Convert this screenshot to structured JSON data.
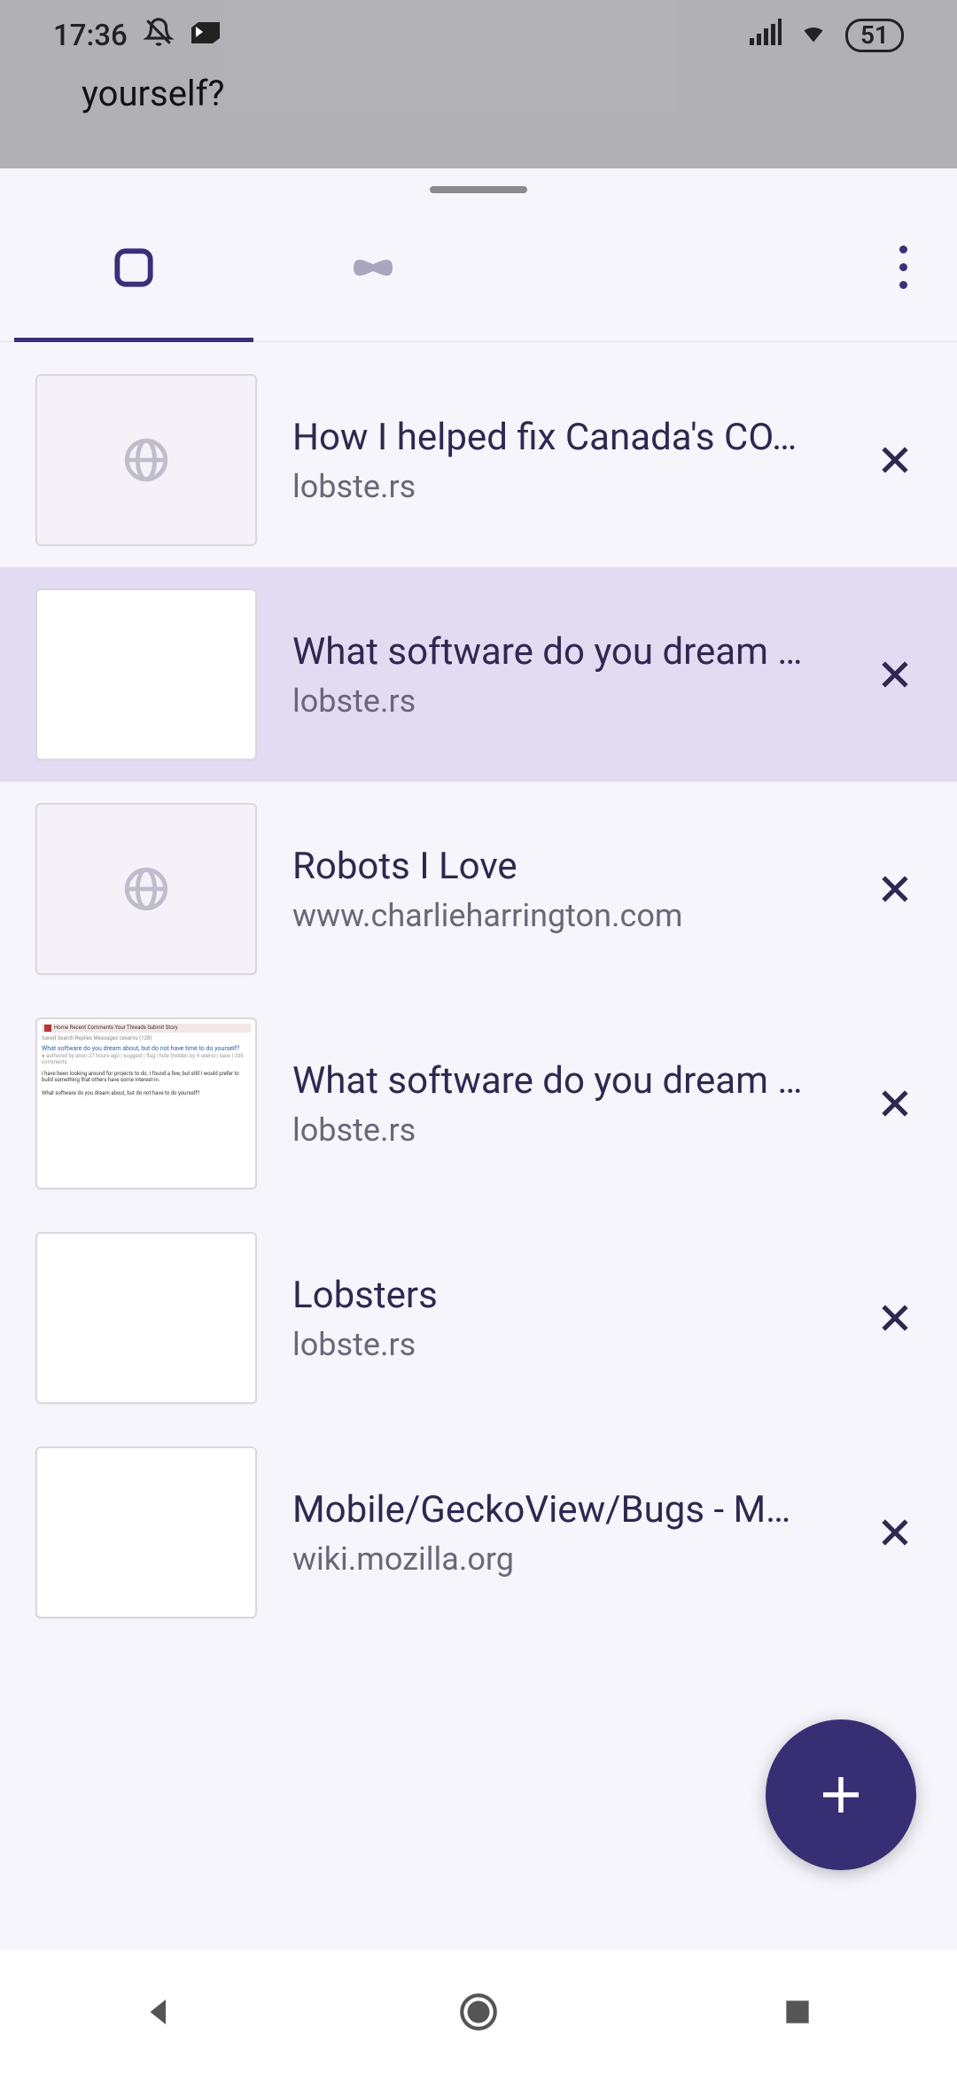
{
  "status": {
    "time": "17:36",
    "battery": "51"
  },
  "underlay": {
    "peek_text": "yourself?"
  },
  "colors": {
    "accent": "#3a2f7a",
    "fab": "#372e74",
    "active_row": "#e2dcf2"
  },
  "tabs": [
    {
      "title": "How I helped fix Canada's CO…",
      "url": "lobste.rs",
      "thumb": "globe",
      "active": false
    },
    {
      "title": "What software do you dream …",
      "url": "lobste.rs",
      "thumb": "blank",
      "active": true
    },
    {
      "title": "Robots I Love",
      "url": "www.charlieharrington.com",
      "thumb": "globe",
      "active": false
    },
    {
      "title": "What software do you dream …",
      "url": "lobste.rs",
      "thumb": "content",
      "active": false
    },
    {
      "title": "Lobsters",
      "url": "lobste.rs",
      "thumb": "blank",
      "active": false
    },
    {
      "title": "Mobile/GeckoView/Bugs - M…",
      "url": "wiki.mozilla.org",
      "thumb": "blank",
      "active": false
    }
  ]
}
